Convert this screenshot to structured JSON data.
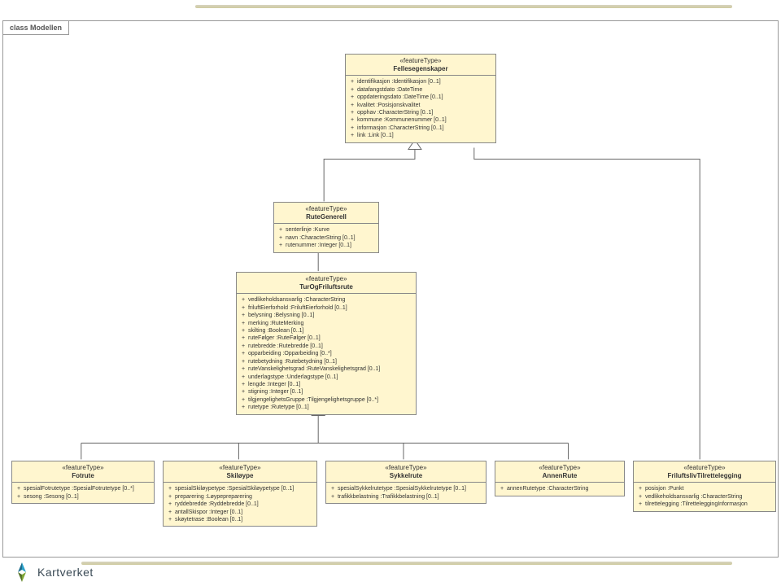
{
  "frame": {
    "label": "class Modellen"
  },
  "classes": {
    "felles": {
      "stereo": "«featureType»",
      "name": "Fellesegenskaper",
      "attrs": [
        "identifikasjon :Identifikasjon [0..1]",
        "datafangstdato :DateTime",
        "oppdateringsdato :DateTime [0..1]",
        "kvalitet :Posisjonskvalitet",
        "opphav :CharacterString [0..1]",
        "kommune :Kommunenummer [0..1]",
        "informasjon :CharacterString [0..1]",
        "link :Link [0..1]"
      ]
    },
    "ruteGenerell": {
      "stereo": "«featureType»",
      "name": "RuteGenerell",
      "attrs": [
        "senterlinje :Kurve",
        "navn :CharacterString [0..1]",
        "rutenummer :Integer [0..1]"
      ]
    },
    "turOg": {
      "stereo": "«featureType»",
      "name": "TurOgFriluftsrute",
      "attrs": [
        "vedlikeholdsansvarlig :CharacterString",
        "friluftEierforhold :FriluftEierforhold [0..1]",
        "belysning :Belysning [0..1]",
        "merking :RuteMerking",
        "skilting :Boolean [0..1]",
        "ruteFølger :RuteFølger [0..1]",
        "rutebredde :Rutebredde [0..1]",
        "opparbeiding :Opparbeiding [0..*]",
        "rutebetydning :Rutebetydning [0..1]",
        "ruteVanskelighetsgrad :RuteVanskelighetsgrad [0..1]",
        "underlagstype :Underlagstype [0..1]",
        "lengde :Integer [0..1]",
        "stigning :Integer [0..1]",
        "tilgjengelighetsGruppe :Tilgjengelighetsgruppe [0..*]",
        "rutetype :Rutetype [0..1]"
      ]
    },
    "fotrute": {
      "stereo": "«featureType»",
      "name": "Fotrute",
      "attrs": [
        "spesialFotrutetype :SpesialFotrutetype [0..*]",
        "sesong :Sesong [0..1]"
      ]
    },
    "skiloype": {
      "stereo": "«featureType»",
      "name": "Skiløype",
      "attrs": [
        "spesialSkiløypetype :SpesialSkiløypetype [0..1]",
        "preparering :Løypepreparering",
        "ryddebredde :Ryddebredde [0..1]",
        "antallSkispor :Integer [0..1]",
        "skøytetrase :Boolean [0..1]"
      ]
    },
    "sykkel": {
      "stereo": "«featureType»",
      "name": "Sykkelrute",
      "attrs": [
        "spesialSykkelrutetype :SpesialSykkelrutetype [0..1]",
        "trafikkbelastning :Trafikkbelastning [0..1]"
      ]
    },
    "annen": {
      "stereo": "«featureType»",
      "name": "AnnenRute",
      "attrs": [
        "annenRutetype :CharacterString"
      ]
    },
    "tilrette": {
      "stereo": "«featureType»",
      "name": "FriluftslivTilrettelegging",
      "attrs": [
        "posisjon :Punkt",
        "vedlikeholdsansvarlig :CharacterString",
        "tilrettelegging :TilretteleggingInformasjon"
      ]
    }
  },
  "logo": {
    "text": "Kartverket"
  }
}
